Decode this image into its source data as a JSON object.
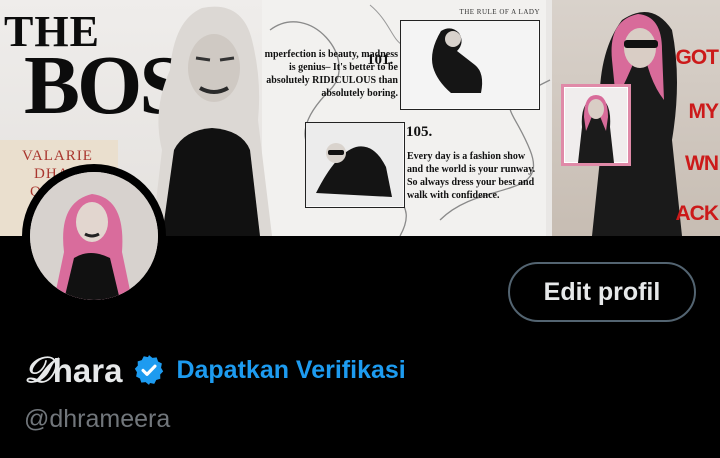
{
  "banner": {
    "title_line1": "THE",
    "title_line2": "BOS",
    "card_line1": "VALARIE",
    "card_line2": "DHARA",
    "card_line3": "OLM",
    "header_text": "THE RULE OF A LADY",
    "rule1_number": "101.",
    "rule1_text": "mperfection is beauty, madness is genius– It's better to be absolutely RIDICULOUS than absolutely boring.",
    "rule2_number": "105.",
    "rule2_text": "Every day is a fashion show and the world is your runway. So always dress your best and walk with confidence.",
    "red_words": [
      "GOT",
      "MY",
      "WN",
      "ACK"
    ],
    "accent_red": "#cc1a1a",
    "accent_pink": "#e08aa8"
  },
  "profile": {
    "edit_button_label": "Edit profil",
    "display_name_initial": "𝒟",
    "display_name_rest": "hara",
    "verify_link_label": "Dapatkan Verifikasi",
    "handle": "@dhrameera",
    "verified_color": "#1d9bf0"
  }
}
